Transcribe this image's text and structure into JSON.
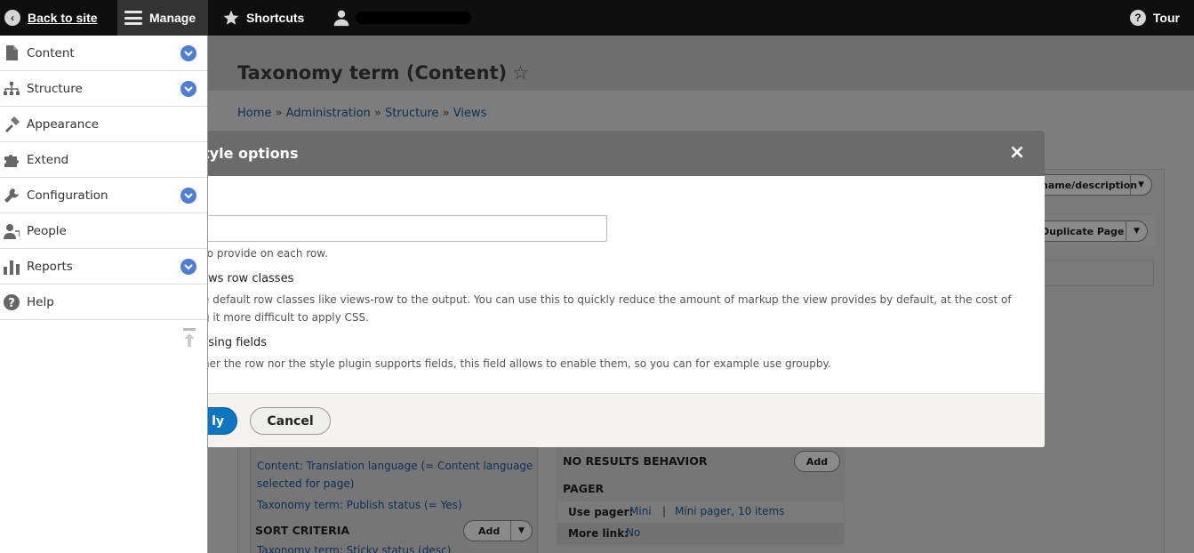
{
  "toolbar": {
    "back_label": "Back to site",
    "manage_label": "Manage",
    "shortcuts_label": "Shortcuts",
    "tour_label": "Tour"
  },
  "page": {
    "title": "Taxonomy term (Content)",
    "star": "☆",
    "breadcrumb": [
      "Home",
      "Administration",
      "Structure",
      "Views"
    ],
    "breadcrumb_sep": "»"
  },
  "background": {
    "name_desc_btn": "name/description",
    "duplicate_btn": "Duplicate Page",
    "filter_line_1": "Content: Translation language (= Content language",
    "filter_line_2": "selected for page)",
    "filter_line_3": "Taxonomy term: Publish status (= Yes)",
    "sort_criteria": "SORT CRITERIA",
    "sort_add_btn": "Add",
    "sort_item": "Taxonomy term: Sticky status (desc)",
    "no_results": "NO RESULTS BEHAVIOR",
    "no_results_add_btn": "Add",
    "pager": "PAGER",
    "use_pager_label": "Use pager:",
    "use_pager_value": "Mini",
    "pager_sep": "|",
    "mini_pager_value": "Mini pager, 10 items",
    "more_link_label": "More link:",
    "more_link_value": "No"
  },
  "sidebar": {
    "items": [
      {
        "label": "Content",
        "icon": "file-icon",
        "expandable": true
      },
      {
        "label": "Structure",
        "icon": "sitemap-icon",
        "expandable": true
      },
      {
        "label": "Appearance",
        "icon": "paintbrush-icon",
        "expandable": false
      },
      {
        "label": "Extend",
        "icon": "puzzle-icon",
        "expandable": false
      },
      {
        "label": "Configuration",
        "icon": "wrench-icon",
        "expandable": true
      },
      {
        "label": "People",
        "icon": "people-icon",
        "expandable": false
      },
      {
        "label": "Reports",
        "icon": "bar-chart-icon",
        "expandable": true
      },
      {
        "label": "Help",
        "icon": "help-icon",
        "expandable": false
      }
    ]
  },
  "modal": {
    "title": "Style options",
    "visible_title": "tyle options",
    "close": "×",
    "row_class_label": "s",
    "row_class_value": "",
    "row_class_desc": "to provide on each row.",
    "default_classes_label": "ews row classes",
    "default_classes_desc_1": "e default row classes like views-row to the output. You can use this to quickly reduce the amount of markup the view provides by default, at the cost of",
    "default_classes_desc_2": "g it more difficult to apply CSS.",
    "force_fields_label": "using fields",
    "force_fields_desc": "her the row nor the style plugin supports fields, this field allows to enable them, so you can for example use groupby.",
    "apply_label": "ly",
    "cancel_label": "Cancel"
  },
  "colors": {
    "toolbar_bg": "#0f0f0f",
    "accent_blue": "#0e75c1",
    "chevron_blue": "#4f7fd2",
    "overlay_gray": "#7d7d7d"
  }
}
